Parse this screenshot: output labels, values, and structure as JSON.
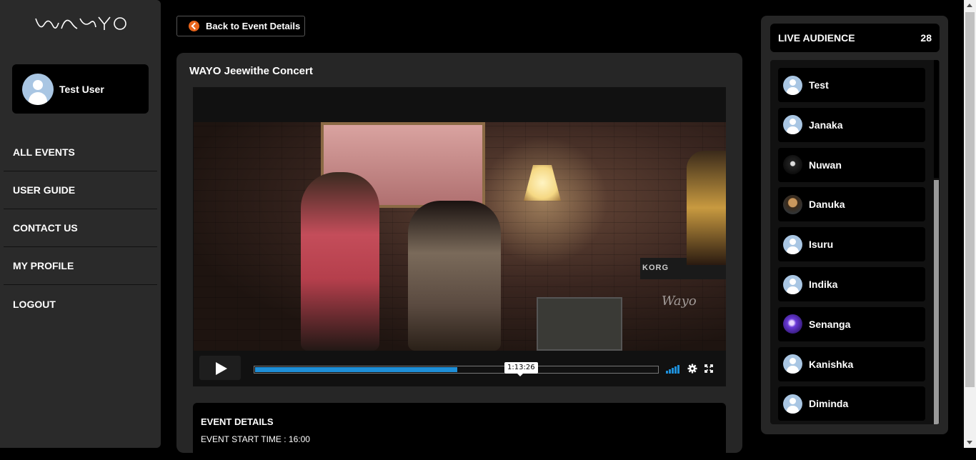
{
  "brand": {
    "logo_icon": "wayo-logo-icon"
  },
  "user": {
    "name": "Test User"
  },
  "nav": {
    "items": [
      {
        "label": "ALL EVENTS"
      },
      {
        "label": "USER GUIDE"
      },
      {
        "label": "CONTACT US"
      },
      {
        "label": "MY PROFILE"
      },
      {
        "label": "LOGOUT"
      }
    ]
  },
  "back_button": {
    "label": "Back to Event Details",
    "icon": "chevron-left-icon",
    "icon_color": "#e8641b"
  },
  "event": {
    "title": "WAYO Jeewithe Concert",
    "video": {
      "scene_keyboard_brand": "KORG",
      "watermark": "Wayo",
      "hover_time": "1:13:26",
      "progress": 0.5,
      "progress_color": "#1e8fd8"
    },
    "details": {
      "heading": "EVENT DETAILS",
      "start_time_line": "EVENT START TIME : 16:00"
    }
  },
  "audience": {
    "heading": "LIVE AUDIENCE",
    "count": "28",
    "members": [
      {
        "name": "Test",
        "avatar": "default"
      },
      {
        "name": "Janaka",
        "avatar": "default"
      },
      {
        "name": "Nuwan",
        "avatar": "photo-dark"
      },
      {
        "name": "Danuka",
        "avatar": "photo-man"
      },
      {
        "name": "Isuru",
        "avatar": "default"
      },
      {
        "name": "Indika",
        "avatar": "default"
      },
      {
        "name": "Senanga",
        "avatar": "photo-purple"
      },
      {
        "name": "Kanishka",
        "avatar": "default"
      },
      {
        "name": "Diminda",
        "avatar": "default"
      }
    ]
  }
}
